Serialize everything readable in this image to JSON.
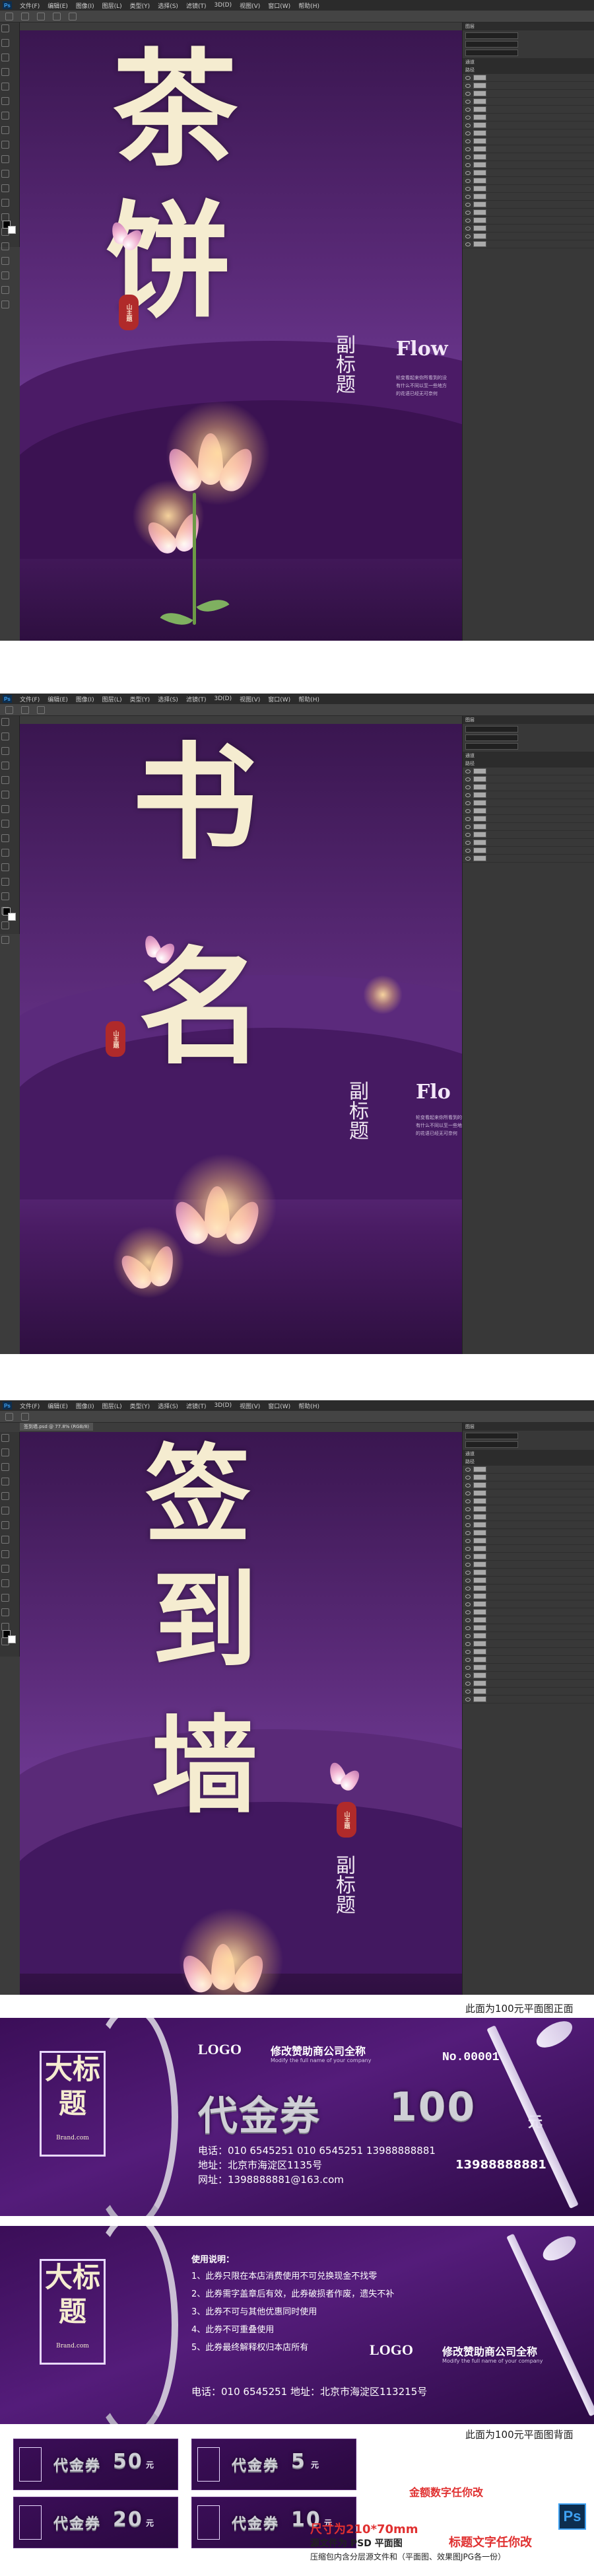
{
  "screens": [
    {
      "menu": [
        "文件(F)",
        "编辑(E)",
        "图像(I)",
        "图层(L)",
        "类型(Y)",
        "选择(S)",
        "滤镜(T)",
        "3D(D)",
        "视图(V)",
        "窗口(W)",
        "帮助(H)"
      ],
      "doc_tab": "未标题-1 @ 66.7% (RGB/8)",
      "title_chars": [
        "茶",
        "饼"
      ],
      "subtitle": "副标题",
      "seal_text": "山主題",
      "flow_text": "Flow",
      "para": "轮变看起来你所看到的没有什么不同以至一些地方的花语已经无可奈何",
      "panel_labels": [
        "图层",
        "通道",
        "路径"
      ]
    },
    {
      "menu": [
        "文件(F)",
        "编辑(E)",
        "图像(I)",
        "图层(L)",
        "类型(Y)",
        "选择(S)",
        "滤镜(T)",
        "3D(D)",
        "视图(V)",
        "窗口(W)",
        "帮助(H)"
      ],
      "doc_tab": "书名.psd @ 50% (RGB/8)",
      "title_chars": [
        "书",
        "名"
      ],
      "subtitle": "副标题",
      "seal_text": "山主題",
      "flow_text": "Flo",
      "para": "轮变看起来你所看到的没有什么不同以至一些地方的花语已经无可奈何",
      "panel_labels": [
        "图层",
        "通道",
        "路径"
      ]
    },
    {
      "menu": [
        "文件(F)",
        "编辑(E)",
        "图像(I)",
        "图层(L)",
        "类型(Y)",
        "选择(S)",
        "滤镜(T)",
        "3D(D)",
        "视图(V)",
        "窗口(W)",
        "帮助(H)"
      ],
      "doc_tab": "签到墙.psd @ 77.8% (RGB/8)",
      "title_chars": [
        "签",
        "到",
        "墙"
      ],
      "subtitle": "副标题",
      "seal_text": "山主題",
      "flow_text": "",
      "para": "",
      "panel_labels": [
        "图层",
        "通道",
        "路径"
      ]
    }
  ],
  "caption_front": "此面为100元平面图正面",
  "caption_back": "此面为100元平面图背面",
  "voucher_front": {
    "title_box": "大标题",
    "title_box_sub": "Brand.com",
    "logo": "LOGO",
    "company": "修改赞助商公司全称",
    "company_en": "Modify the full name of your company",
    "number": "No.00001",
    "big_text": "代金券",
    "amount": "100",
    "unit": "元",
    "phone": "电话：010 6545251   010 6545251   13988888881",
    "address": "地址：北京市海淀区1135号",
    "mobile": "13988888881",
    "web": "网址：1398888881@163.com",
    "mobile2": "13988888881"
  },
  "voucher_back": {
    "title_box": "大标题",
    "title_box_sub": "Brand.com",
    "rules_title": "使用说明：",
    "rules": [
      "1、此券只限在本店消费使用不可兑换现金不找零",
      "2、此券需字盖章后有效，此券破损者作废，遗失不补",
      "3、此券不可与其他优惠同时使用",
      "4、此券不可重叠使用",
      "5、此券最终解释权归本店所有"
    ],
    "logo": "LOGO",
    "company": "修改赞助商公司全称",
    "company_en": "Modify the full name of your company",
    "contact": "电话：010 6545251   地址：北京市海淀区113215号"
  },
  "mini_vouchers": [
    {
      "label": "代金券",
      "amount": "50",
      "unit": "元"
    },
    {
      "label": "代金券",
      "amount": "5",
      "unit": "元"
    },
    {
      "label": "代金券",
      "amount": "20",
      "unit": "元"
    },
    {
      "label": "代金券",
      "amount": "10",
      "unit": "元"
    }
  ],
  "amount_note": "金额数字任你改",
  "size_note": "尺寸为210*70mm",
  "source_note": "源文件为 PSD 平面图",
  "title_note": "标题文字任你改",
  "package_note": "压缩包内含分层源文件和（平面图、效果图JPG各一份）",
  "ps_badge": "Ps",
  "colors": {
    "accent_red": "#e03030",
    "deep_purple": "#3b0e58",
    "cream": "#f5ecd0"
  }
}
